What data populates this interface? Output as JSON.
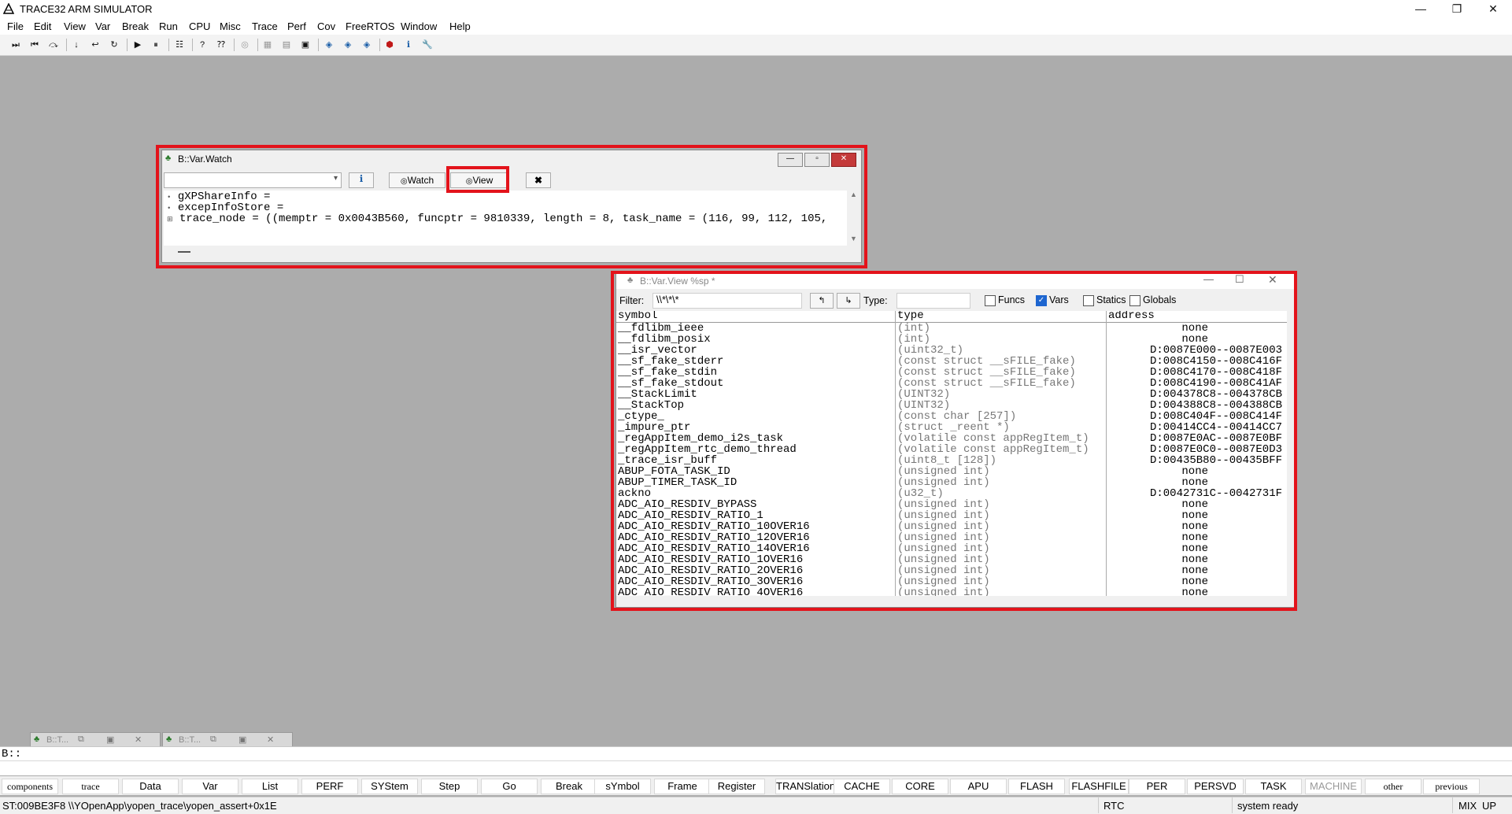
{
  "app": {
    "title": "TRACE32 ARM SIMULATOR",
    "window_controls": {
      "minimize": "—",
      "restore": "❐",
      "close": "✕"
    }
  },
  "menu": [
    "File",
    "Edit",
    "View",
    "Var",
    "Break",
    "Run",
    "CPU",
    "Misc",
    "Trace",
    "Perf",
    "Cov",
    "FreeRTOS",
    "Window",
    "Help"
  ],
  "watch_window": {
    "title": "B::Var.Watch",
    "watch_button": "Watch",
    "view_button": "View",
    "lines": [
      {
        "marker": "•",
        "text": "gXPShareInfo ="
      },
      {
        "marker": "•",
        "text": "excepInfoStore ="
      },
      {
        "marker": "⊞",
        "text": "trace_node = ((memptr = 0x0043B560, funcptr = 9810339, length = 8, task_name = (116, 99, 112, 105,"
      }
    ]
  },
  "view_window": {
    "title": "B::Var.View %sp *",
    "filter_label": "Filter:",
    "filter_value": "\\\\*\\*\\*",
    "type_label": "Type:",
    "type_value": "",
    "checkboxes": [
      {
        "label": "Funcs",
        "checked": false
      },
      {
        "label": "Vars",
        "checked": true
      },
      {
        "label": "Statics",
        "checked": false
      },
      {
        "label": "Globals",
        "checked": false
      }
    ],
    "columns": [
      "symbol",
      "type",
      "address"
    ],
    "rows": [
      {
        "symbol": "__fdlibm_ieee",
        "type": "(int)",
        "address": "none"
      },
      {
        "symbol": "__fdlibm_posix",
        "type": "(int)",
        "address": "none"
      },
      {
        "symbol": "__isr_vector",
        "type": "(uint32_t)",
        "address": "D:0087E000--0087E003"
      },
      {
        "symbol": "__sf_fake_stderr",
        "type": "(const struct __sFILE_fake)",
        "address": "D:008C4150--008C416F"
      },
      {
        "symbol": "__sf_fake_stdin",
        "type": "(const struct __sFILE_fake)",
        "address": "D:008C4170--008C418F"
      },
      {
        "symbol": "__sf_fake_stdout",
        "type": "(const struct __sFILE_fake)",
        "address": "D:008C4190--008C41AF"
      },
      {
        "symbol": "__StackLimit",
        "type": "(UINT32)",
        "address": "D:004378C8--004378CB"
      },
      {
        "symbol": "__StackTop",
        "type": "(UINT32)",
        "address": "D:004388C8--004388CB"
      },
      {
        "symbol": "_ctype_",
        "type": "(const char [257])",
        "address": "D:008C404F--008C414F"
      },
      {
        "symbol": "_impure_ptr",
        "type": "(struct _reent *)",
        "address": "D:00414CC4--00414CC7"
      },
      {
        "symbol": "_regAppItem_demo_i2s_task",
        "type": "(volatile const appRegItem_t)",
        "address": "D:0087E0AC--0087E0BF"
      },
      {
        "symbol": "_regAppItem_rtc_demo_thread",
        "type": "(volatile const appRegItem_t)",
        "address": "D:0087E0C0--0087E0D3"
      },
      {
        "symbol": "_trace_isr_buff",
        "type": "(uint8_t [128])",
        "address": "D:00435B80--00435BFF"
      },
      {
        "symbol": "ABUP_FOTA_TASK_ID",
        "type": "(unsigned int)",
        "address": "none"
      },
      {
        "symbol": "ABUP_TIMER_TASK_ID",
        "type": "(unsigned int)",
        "address": "none"
      },
      {
        "symbol": "ackno",
        "type": "(u32_t)",
        "address": "D:0042731C--0042731F"
      },
      {
        "symbol": "ADC_AIO_RESDIV_BYPASS",
        "type": "(unsigned int)",
        "address": "none"
      },
      {
        "symbol": "ADC_AIO_RESDIV_RATIO_1",
        "type": "(unsigned int)",
        "address": "none"
      },
      {
        "symbol": "ADC_AIO_RESDIV_RATIO_10OVER16",
        "type": "(unsigned int)",
        "address": "none"
      },
      {
        "symbol": "ADC_AIO_RESDIV_RATIO_12OVER16",
        "type": "(unsigned int)",
        "address": "none"
      },
      {
        "symbol": "ADC_AIO_RESDIV_RATIO_14OVER16",
        "type": "(unsigned int)",
        "address": "none"
      },
      {
        "symbol": "ADC_AIO_RESDIV_RATIO_1OVER16",
        "type": "(unsigned int)",
        "address": "none"
      },
      {
        "symbol": "ADC_AIO_RESDIV_RATIO_2OVER16",
        "type": "(unsigned int)",
        "address": "none"
      },
      {
        "symbol": "ADC_AIO_RESDIV_RATIO_3OVER16",
        "type": "(unsigned int)",
        "address": "none"
      },
      {
        "symbol": "ADC_AIO_RESDIV_RATIO_4OVER16",
        "type": "(unsigned int)",
        "address": "none"
      }
    ]
  },
  "minimized": [
    {
      "label": "B::T..."
    },
    {
      "label": "B::T..."
    }
  ],
  "command_prompt": "B::",
  "softkeys": [
    "components",
    "trace",
    "Data",
    "Var",
    "List",
    "PERF",
    "SYStem",
    "Step",
    "Go",
    "Break",
    "sYmbol",
    "Frame",
    "Register",
    "TRANSlation",
    "CACHE",
    "CORE",
    "APU",
    "FLASH",
    "FLASHFILE",
    "PER",
    "PERSVD",
    "TASK",
    "MACHINE",
    "other",
    "previous"
  ],
  "status": {
    "location": "ST:009BE3F8  \\\\YOpenApp\\yopen_trace\\yopen_assert+0x1E",
    "rtc": "RTC",
    "state": "system ready",
    "mix": "MIX",
    "up": "UP"
  }
}
